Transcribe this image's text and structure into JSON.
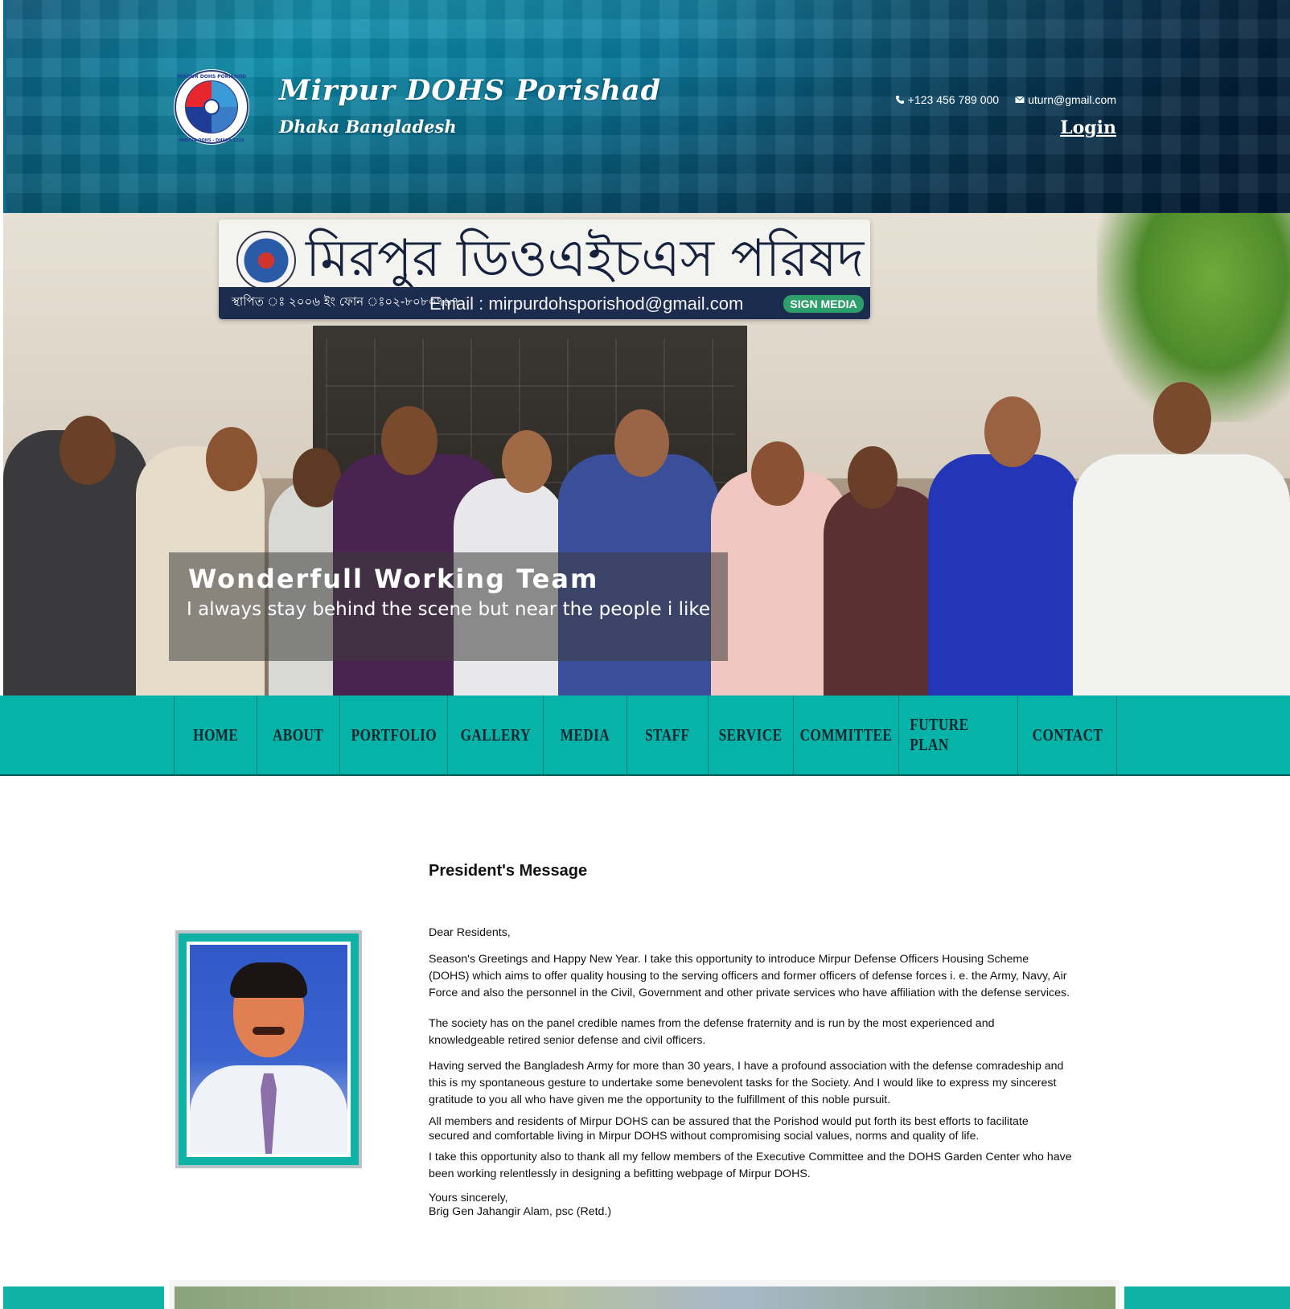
{
  "header": {
    "title": "Mirpur DOHS Porishad",
    "subtitle": "Dhaka Bangladesh",
    "phone": "+123 456 789 000",
    "email": "uturn@gmail.com",
    "login_label": "Login",
    "logo": {
      "top_text": "MIRPUR DOHS PORISHOD",
      "bottom_text": "MIRPUR DOHS - DHAKA 1216"
    }
  },
  "hero": {
    "sign_bengali": "মিরপুর ডিওএইচএস পরিষদ",
    "sign_info": "স্থাপিত ঃ ২০০৬ ইং  ফোন ঃ০২-৮০৮০৭৯৭",
    "sign_email": "Email : mirpurdohsporishod@gmail.com",
    "sign_badge": "SIGN MEDIA",
    "caption_title": "Wonderfull Working Team",
    "caption_text": "I always stay behind the scene but near the people i like"
  },
  "nav": {
    "items": [
      {
        "label": "HOME"
      },
      {
        "label": "ABOUT"
      },
      {
        "label": "PORTFOLIO"
      },
      {
        "label": "GALLERY"
      },
      {
        "label": "MEDIA"
      },
      {
        "label": "STAFF"
      },
      {
        "label": "SERVICE"
      },
      {
        "label": "COMMITTEE"
      },
      {
        "label": "FUTURE PLAN"
      },
      {
        "label": "CONTACT"
      }
    ]
  },
  "message": {
    "title": "President's Message",
    "salutation": "Dear Residents,",
    "paragraphs": [
      "Season's Greetings and Happy New Year. I take this opportunity to introduce Mirpur Defense Officers Housing Scheme (DOHS) which aims to offer quality housing to the serving officers and former officers of defense forces i. e. the Army, Navy, Air Force and also the personnel in the Civil, Government and other private services who have affiliation with the defense services.",
      "The society has on the panel credible names from the defense fraternity and is run by the most experienced and knowledgeable retired senior defense and civil officers.",
      "Having served the Bangladesh Army for more than 30 years, I have a profound association with the defense comradeship and this is my spontaneous gesture to undertake some benevolent tasks for the Society. And I would like to express my sincerest gratitude to you all who have given me the opportunity to the fulfillment of this noble pursuit.",
      "All members and residents of Mirpur DOHS can be assured that the Porishod would put forth its best efforts to facilitate secured and comfortable living in Mirpur DOHS without compromising social values, norms and quality of life.",
      "I take this opportunity also to thank all my fellow members of the Executive Committee and the DOHS Garden Center who have been working relentlessly in designing a befitting webpage of Mirpur DOHS."
    ],
    "closing": "Yours sincerely,",
    "signature": "Brig Gen Jahangir Alam, psc (Retd.)"
  },
  "colors": {
    "nav_bg": "#06b3a8",
    "header_dark": "#052c47",
    "header_light": "#0b8eab",
    "text": "#111111"
  },
  "icons": [
    "phone-icon",
    "envelope-icon"
  ]
}
